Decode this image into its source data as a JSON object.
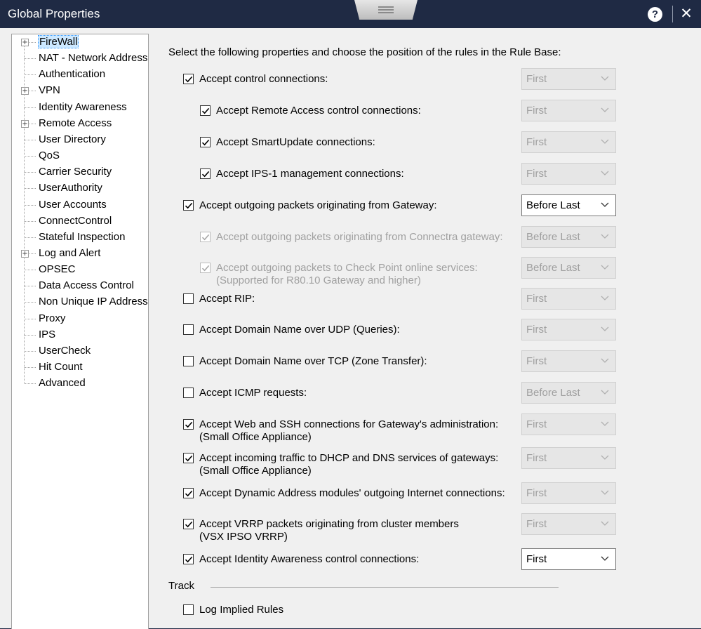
{
  "window": {
    "title": "Global Properties"
  },
  "icons": {
    "help": "help-icon",
    "close": "close-icon",
    "checkmark": "check-icon",
    "chevron": "chevron-down-icon",
    "expand": "plus-expander-icon"
  },
  "colors": {
    "titlebar": "#1f2a44",
    "selection": "#cce8ff",
    "panel": "#f0f0f0"
  },
  "titlebar": {
    "help_glyph": "?",
    "close_glyph": "✕"
  },
  "tree": {
    "items": [
      {
        "label": "FireWall",
        "expandable": true,
        "selected": true
      },
      {
        "label": "NAT - Network Address Translation",
        "expandable": false
      },
      {
        "label": "Authentication",
        "expandable": false
      },
      {
        "label": "VPN",
        "expandable": true
      },
      {
        "label": "Identity Awareness",
        "expandable": false
      },
      {
        "label": "Remote Access",
        "expandable": true
      },
      {
        "label": "User Directory",
        "expandable": false
      },
      {
        "label": "QoS",
        "expandable": false
      },
      {
        "label": "Carrier Security",
        "expandable": false
      },
      {
        "label": "UserAuthority",
        "expandable": false
      },
      {
        "label": "User Accounts",
        "expandable": false
      },
      {
        "label": "ConnectControl",
        "expandable": false
      },
      {
        "label": "Stateful Inspection",
        "expandable": false
      },
      {
        "label": "Log and Alert",
        "expandable": true
      },
      {
        "label": "OPSEC",
        "expandable": false
      },
      {
        "label": "Data Access Control",
        "expandable": false
      },
      {
        "label": "Non Unique IP Address Ranges",
        "expandable": false
      },
      {
        "label": "Proxy",
        "expandable": false
      },
      {
        "label": "IPS",
        "expandable": false
      },
      {
        "label": "UserCheck",
        "expandable": false
      },
      {
        "label": "Hit Count",
        "expandable": false
      },
      {
        "label": "Advanced",
        "expandable": false
      }
    ]
  },
  "main": {
    "intro": "Select the following properties and choose the position of the rules in the Rule Base:",
    "rules": [
      {
        "label": "Accept control connections:",
        "checked": true,
        "enabled": true,
        "position": "First",
        "position_enabled": false
      },
      {
        "label": "Accept Remote Access control connections:",
        "checked": true,
        "enabled": true,
        "position": "First",
        "position_enabled": false
      },
      {
        "label": "Accept SmartUpdate connections:",
        "checked": true,
        "enabled": true,
        "position": "First",
        "position_enabled": false
      },
      {
        "label": "Accept IPS-1 management connections:",
        "checked": true,
        "enabled": true,
        "position": "First",
        "position_enabled": false
      },
      {
        "label": "Accept outgoing packets originating from Gateway:",
        "checked": true,
        "enabled": true,
        "position": "Before Last",
        "position_enabled": true
      },
      {
        "label": "Accept outgoing packets originating from Connectra gateway:",
        "checked": true,
        "enabled": false,
        "position": "Before Last",
        "position_enabled": false
      },
      {
        "label": "Accept outgoing packets to Check Point online services:",
        "label2": "(Supported for R80.10 Gateway and higher)",
        "checked": true,
        "enabled": false,
        "position": "Before Last",
        "position_enabled": false
      },
      {
        "label": "Accept RIP:",
        "checked": false,
        "enabled": true,
        "position": "First",
        "position_enabled": false
      },
      {
        "label": "Accept Domain Name over UDP (Queries):",
        "checked": false,
        "enabled": true,
        "position": "First",
        "position_enabled": false
      },
      {
        "label": "Accept Domain Name over TCP (Zone Transfer):",
        "checked": false,
        "enabled": true,
        "position": "First",
        "position_enabled": false
      },
      {
        "label": "Accept ICMP requests:",
        "checked": false,
        "enabled": true,
        "position": "Before Last",
        "position_enabled": false
      },
      {
        "label": "Accept Web and SSH connections for Gateway's administration:",
        "label2": "(Small Office Appliance)",
        "checked": true,
        "enabled": true,
        "position": "First",
        "position_enabled": false
      },
      {
        "label": "Accept incoming traffic to DHCP and DNS services of gateways:",
        "label2": "(Small Office Appliance)",
        "checked": true,
        "enabled": true,
        "position": "First",
        "position_enabled": false
      },
      {
        "label": "Accept Dynamic Address modules' outgoing Internet connections:",
        "checked": true,
        "enabled": true,
        "position": "First",
        "position_enabled": false
      },
      {
        "label": "Accept VRRP packets originating from cluster members",
        "label2": "(VSX IPSO VRRP)",
        "checked": true,
        "enabled": true,
        "position": "First",
        "position_enabled": false
      },
      {
        "label": "Accept Identity Awareness control connections:",
        "checked": true,
        "enabled": true,
        "position": "First",
        "position_enabled": true
      }
    ],
    "track": {
      "label": "Track",
      "log_implied_rules": {
        "label": "Log Implied Rules",
        "checked": false
      }
    }
  }
}
